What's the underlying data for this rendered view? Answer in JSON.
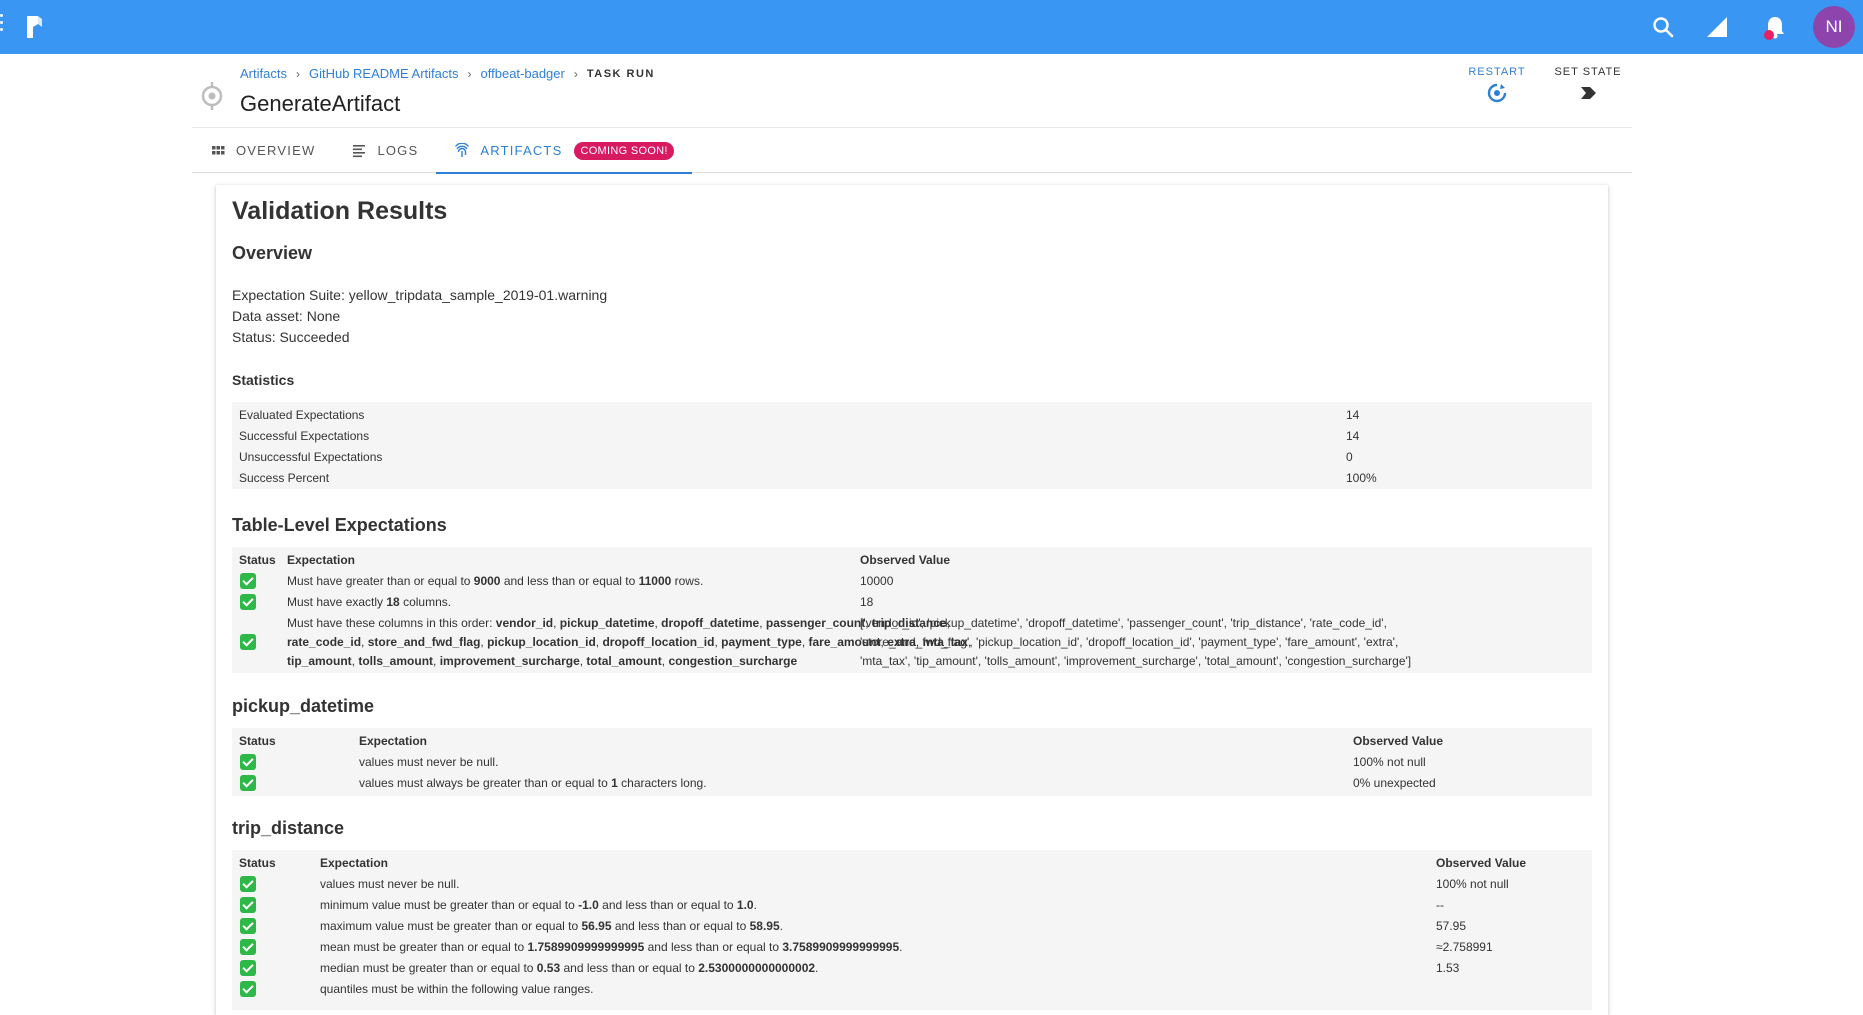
{
  "topbar": {
    "avatar_initials": "NI",
    "icons": [
      "menu-dots-icon",
      "prefect-logo",
      "search-icon",
      "signal-icon",
      "notifications-bell-icon"
    ]
  },
  "breadcrumbs": [
    {
      "label": "Artifacts"
    },
    {
      "label": "GitHub README Artifacts"
    },
    {
      "label": "offbeat-badger"
    }
  ],
  "breadcrumb_current": "TASK RUN",
  "page_title": "GenerateArtifact",
  "actions": {
    "restart": "RESTART",
    "set_state": "SET STATE"
  },
  "tabs": [
    {
      "label": "OVERVIEW",
      "icon": "grid-icon"
    },
    {
      "label": "LOGS",
      "icon": "logs-icon"
    },
    {
      "label": "ARTIFACTS",
      "icon": "fingerprint-icon",
      "badge": "COMING SOON!"
    }
  ],
  "report": {
    "title": "Validation Results",
    "overview_heading": "Overview",
    "overview_lines": [
      "Expectation Suite: yellow_tripdata_sample_2019-01.warning",
      "Data asset: None",
      "Status: Succeeded"
    ],
    "statistics_heading": "Statistics",
    "statistics": [
      {
        "label": "Evaluated Expectations",
        "value": "14"
      },
      {
        "label": "Successful Expectations",
        "value": "14"
      },
      {
        "label": "Unsuccessful Expectations",
        "value": "0"
      },
      {
        "label": "Success Percent",
        "value": "100%"
      }
    ],
    "col_status": "Status",
    "col_expectation": "Expectation",
    "col_observed": "Observed Value",
    "table_level": {
      "heading": "Table-Level Expectations",
      "rows": [
        {
          "p": [
            "Must have greater than or equal to ",
            "9000",
            " and less than or equal to ",
            "11000",
            " rows."
          ],
          "observed": [
            "10000"
          ]
        },
        {
          "p": [
            "Must have exactly ",
            "18",
            " columns."
          ],
          "observed": [
            "18"
          ]
        },
        {
          "lines": [
            [
              "Must have these columns in this order: ",
              "vendor_id",
              ", ",
              "pickup_datetime",
              ", ",
              "dropoff_datetime",
              ", ",
              "passenger_count",
              ", ",
              "trip_distance",
              ","
            ],
            [
              "",
              "rate_code_id",
              ", ",
              "store_and_fwd_flag",
              ", ",
              "pickup_location_id",
              ", ",
              "dropoff_location_id",
              ", ",
              "payment_type",
              ", ",
              "fare_amount",
              ", ",
              "extra",
              ", ",
              "mta_tax",
              ","
            ],
            [
              "",
              "tip_amount",
              ", ",
              "tolls_amount",
              ", ",
              "improvement_surcharge",
              ", ",
              "total_amount",
              ", ",
              "congestion_surcharge"
            ]
          ],
          "observed": [
            "['vendor_id', 'pickup_datetime', 'dropoff_datetime', 'passenger_count', 'trip_distance', 'rate_code_id',",
            "'store_and_fwd_flag', 'pickup_location_id', 'dropoff_location_id', 'payment_type', 'fare_amount', 'extra',",
            "'mta_tax', 'tip_amount', 'tolls_amount', 'improvement_surcharge', 'total_amount', 'congestion_surcharge']"
          ]
        }
      ]
    },
    "pickup": {
      "heading": "pickup_datetime",
      "rows": [
        {
          "p": [
            "values must never be null."
          ],
          "observed": [
            "100% not null"
          ]
        },
        {
          "p": [
            "values must always be greater than or equal to ",
            "1",
            " characters long."
          ],
          "observed": [
            "0% unexpected"
          ]
        }
      ]
    },
    "trip": {
      "heading": "trip_distance",
      "rows": [
        {
          "p": [
            "values must never be null."
          ],
          "observed": [
            "100% not null"
          ]
        },
        {
          "p": [
            "minimum value must be greater than or equal to ",
            "-1.0",
            " and less than or equal to ",
            "1.0",
            "."
          ],
          "observed": [
            "--"
          ]
        },
        {
          "p": [
            "maximum value must be greater than or equal to ",
            "56.95",
            " and less than or equal to ",
            "58.95",
            "."
          ],
          "observed": [
            "57.95"
          ]
        },
        {
          "p": [
            "mean must be greater than or equal to ",
            "1.7589909999999995",
            " and less than or equal to ",
            "3.7589909999999995",
            "."
          ],
          "observed": [
            "≈2.758991"
          ]
        },
        {
          "p": [
            "median must be greater than or equal to ",
            "0.53",
            " and less than or equal to ",
            "2.5300000000000002",
            "."
          ],
          "observed": [
            "1.53"
          ]
        },
        {
          "p": [
            "quantiles must be within the following value ranges."
          ],
          "observed": []
        }
      ]
    }
  }
}
